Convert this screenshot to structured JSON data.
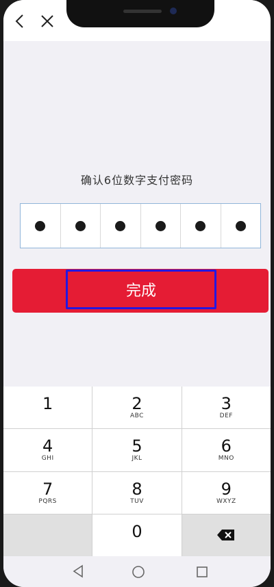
{
  "header": {
    "back_icon": "chevron-left-icon",
    "close_icon": "close-icon"
  },
  "prompt": "确认6位数字支付密码",
  "password": {
    "length": 6,
    "filled": 6
  },
  "confirm_label": "完成",
  "keypad": {
    "keys": [
      {
        "num": "1",
        "letters": ""
      },
      {
        "num": "2",
        "letters": "ABC"
      },
      {
        "num": "3",
        "letters": "DEF"
      },
      {
        "num": "4",
        "letters": "GHI"
      },
      {
        "num": "5",
        "letters": "JKL"
      },
      {
        "num": "6",
        "letters": "MNO"
      },
      {
        "num": "7",
        "letters": "PQRS"
      },
      {
        "num": "8",
        "letters": "TUV"
      },
      {
        "num": "9",
        "letters": "WXYZ"
      },
      {
        "num": "0",
        "letters": ""
      }
    ],
    "delete_icon": "backspace-icon"
  },
  "colors": {
    "confirm_bg": "#e51c34",
    "highlight_border": "#2417e0",
    "box_border": "#8fb5d9"
  }
}
